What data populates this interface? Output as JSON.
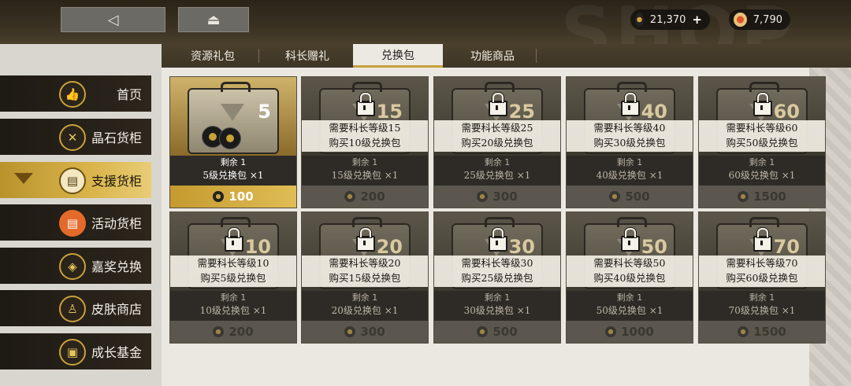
{
  "topbar": {
    "back_icon": "back-arrow-icon",
    "home_icon": "eject-home-icon",
    "currency_primary": {
      "value": "21,370",
      "plus": "+"
    },
    "currency_secondary": {
      "value": "7,790"
    }
  },
  "tabs": [
    {
      "label": "资源礼包"
    },
    {
      "label": "科长赠礼"
    },
    {
      "label": "兑换包",
      "active": true
    },
    {
      "label": "功能商品"
    }
  ],
  "sidebar": {
    "items": [
      {
        "label": "首页",
        "icon": "thumbs-up-icon"
      },
      {
        "label": "晶石货柜",
        "icon": "crossed-swords-icon"
      },
      {
        "label": "支援货柜",
        "icon": "crate-icon",
        "active": true
      },
      {
        "label": "活动货柜",
        "icon": "activity-crate-icon"
      },
      {
        "label": "嘉奖兑换",
        "icon": "badge-icon"
      },
      {
        "label": "皮肤商店",
        "icon": "uniform-icon"
      },
      {
        "label": "成长基金",
        "icon": "fund-chest-icon"
      }
    ]
  },
  "cards": [
    {
      "num": "5",
      "remain": "剩余 1",
      "name": "5级兑换包 ×1",
      "price": "100",
      "locked": false
    },
    {
      "num": "15",
      "lock1": "需要科长等级15",
      "lock2": "购买10级兑换包",
      "remain": "剩余 1",
      "name": "15级兑换包 ×1",
      "price": "200",
      "locked": true
    },
    {
      "num": "25",
      "lock1": "需要科长等级25",
      "lock2": "购买20级兑换包",
      "remain": "剩余 1",
      "name": "25级兑换包 ×1",
      "price": "300",
      "locked": true
    },
    {
      "num": "40",
      "lock1": "需要科长等级40",
      "lock2": "购买30级兑换包",
      "remain": "剩余 1",
      "name": "40级兑换包 ×1",
      "price": "500",
      "locked": true
    },
    {
      "num": "60",
      "lock1": "需要科长等级60",
      "lock2": "购买50级兑换包",
      "remain": "剩余 1",
      "name": "60级兑换包 ×1",
      "price": "1500",
      "locked": true
    },
    {
      "num": "10",
      "lock1": "需要科长等级10",
      "lock2": "购买5级兑换包",
      "remain": "剩余 1",
      "name": "10级兑换包 ×1",
      "price": "200",
      "locked": true
    },
    {
      "num": "20",
      "lock1": "需要科长等级20",
      "lock2": "购买15级兑换包",
      "remain": "剩余 1",
      "name": "20级兑换包 ×1",
      "price": "300",
      "locked": true
    },
    {
      "num": "30",
      "lock1": "需要科长等级30",
      "lock2": "购买25级兑换包",
      "remain": "剩余 1",
      "name": "30级兑换包 ×1",
      "price": "500",
      "locked": true
    },
    {
      "num": "50",
      "lock1": "需要科长等级50",
      "lock2": "购买40级兑换包",
      "remain": "剩余 1",
      "name": "50级兑换包 ×1",
      "price": "1000",
      "locked": true
    },
    {
      "num": "70",
      "lock1": "需要科长等级70",
      "lock2": "购买60级兑换包",
      "remain": "剩余 1",
      "name": "70级兑换包 ×1",
      "price": "1500",
      "locked": true
    }
  ]
}
